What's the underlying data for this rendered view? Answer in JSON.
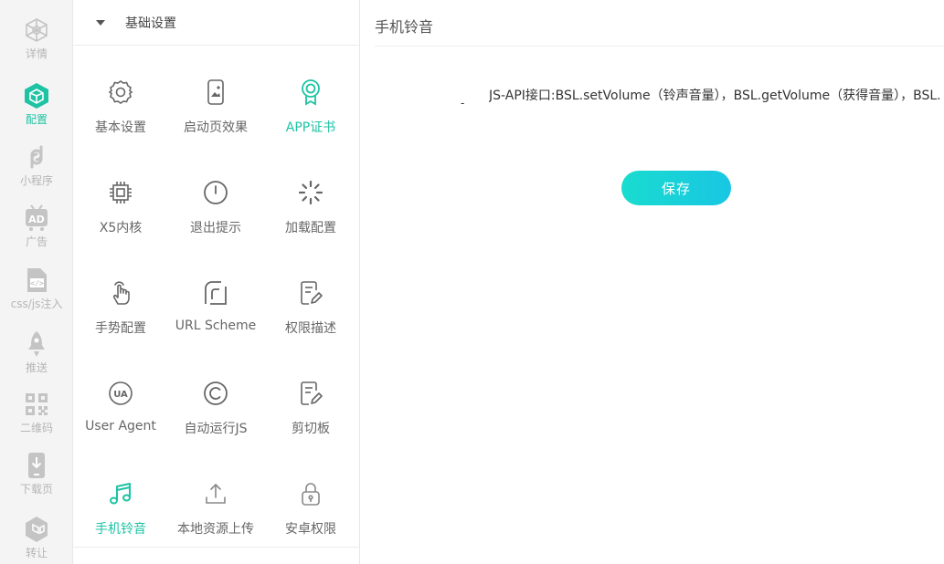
{
  "rail": {
    "items": [
      {
        "label": "详情",
        "icon": "network-icon"
      },
      {
        "label": "配置",
        "icon": "cube-icon",
        "active": true
      },
      {
        "label": "小程序",
        "icon": "mini-program-icon"
      },
      {
        "label": "广告",
        "icon": "ad-icon"
      },
      {
        "label": "css/js注入",
        "icon": "code-file-icon"
      },
      {
        "label": "推送",
        "icon": "rocket-icon"
      },
      {
        "label": "二维码",
        "icon": "qr-code-icon"
      },
      {
        "label": "下载页",
        "icon": "download-page-icon"
      },
      {
        "label": "转让",
        "icon": "transfer-icon"
      }
    ]
  },
  "panel": {
    "section_title": "基础设置",
    "items": [
      {
        "label": "基本设置",
        "icon": "gear-icon"
      },
      {
        "label": "启动页效果",
        "icon": "splash-image-icon"
      },
      {
        "label": "APP证书",
        "icon": "certificate-icon"
      },
      {
        "label": "X5内核",
        "icon": "chip-icon"
      },
      {
        "label": "退出提示",
        "icon": "power-icon"
      },
      {
        "label": "加载配置",
        "icon": "loading-spinner-icon"
      },
      {
        "label": "手势配置",
        "icon": "hand-pointer-icon"
      },
      {
        "label": "URL Scheme",
        "icon": "url-scheme-icon"
      },
      {
        "label": "权限描述",
        "icon": "edit-document-icon"
      },
      {
        "label": "User Agent",
        "icon": "ua-icon"
      },
      {
        "label": "自动运行JS",
        "icon": "copyright-icon"
      },
      {
        "label": "剪切板",
        "icon": "clipboard-edit-icon"
      },
      {
        "label": "手机铃音",
        "icon": "music-note-icon",
        "active": true
      },
      {
        "label": "本地资源上传",
        "icon": "upload-icon"
      },
      {
        "label": "安卓权限",
        "icon": "lock-icon"
      }
    ]
  },
  "content": {
    "title": "手机铃音",
    "dash": "-",
    "api_text": "JS-API接口:BSL.setVolume（铃声音量），BSL.getVolume（获得音量），BSL.",
    "save_label": "保存"
  },
  "colors": {
    "accent": "#1ec3a4",
    "icon_gray": "#666666",
    "rail_gray": "#b5b5b5",
    "button_start": "#19dccf",
    "button_end": "#19c6e3"
  }
}
